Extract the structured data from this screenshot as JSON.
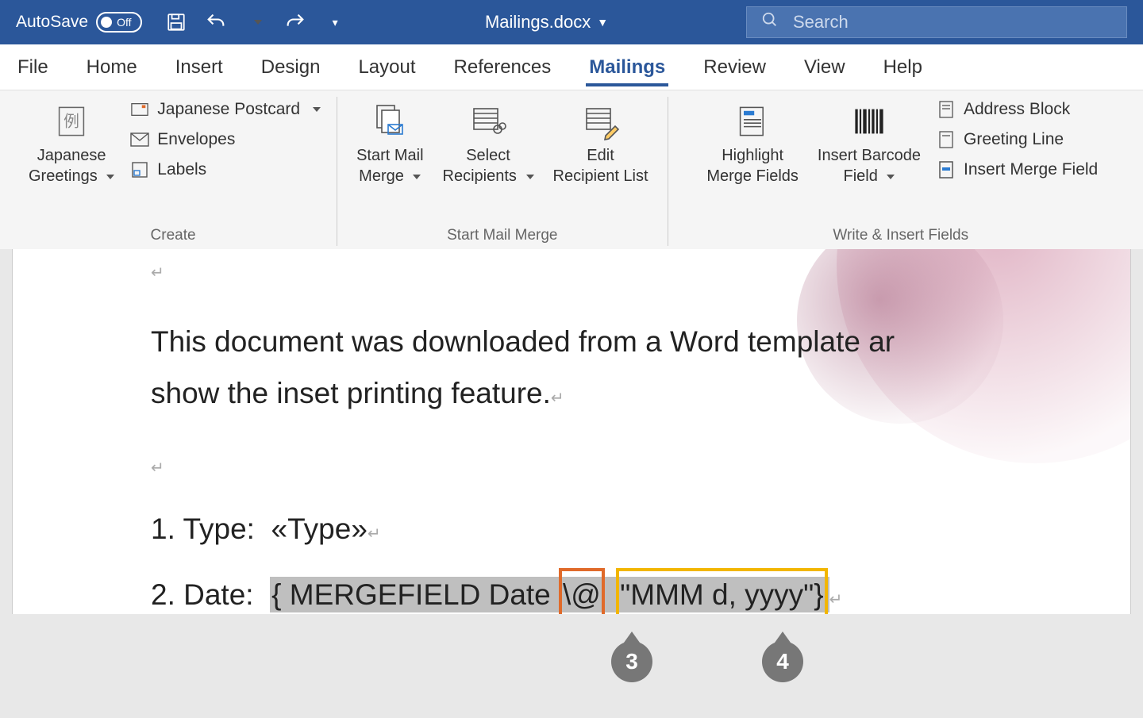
{
  "titlebar": {
    "autosave_label": "AutoSave",
    "autosave_state": "Off",
    "filename": "Mailings.docx",
    "search_placeholder": "Search"
  },
  "tabs": [
    "File",
    "Home",
    "Insert",
    "Design",
    "Layout",
    "References",
    "Mailings",
    "Review",
    "View",
    "Help"
  ],
  "active_tab_index": 6,
  "ribbon": {
    "groups": [
      {
        "label": "Create",
        "big": [
          {
            "line1": "Japanese",
            "line2": "Greetings"
          }
        ],
        "small": [
          {
            "label": "Japanese Postcard",
            "has_dropdown": true,
            "icon": "postcard-icon"
          },
          {
            "label": "Envelopes",
            "has_dropdown": false,
            "icon": "envelope-icon"
          },
          {
            "label": "Labels",
            "has_dropdown": false,
            "icon": "labels-icon"
          }
        ]
      },
      {
        "label": "Start Mail Merge",
        "big": [
          {
            "line1": "Start Mail",
            "line2": "Merge",
            "has_dropdown": true,
            "icon": "start-mail-merge-icon"
          },
          {
            "line1": "Select",
            "line2": "Recipients",
            "has_dropdown": true,
            "icon": "select-recipients-icon"
          },
          {
            "line1": "Edit",
            "line2": "Recipient List",
            "has_dropdown": false,
            "icon": "edit-recipient-list-icon"
          }
        ]
      },
      {
        "label": "Write & Insert Fields",
        "big": [
          {
            "line1": "Highlight",
            "line2": "Merge Fields",
            "has_dropdown": false,
            "icon": "highlight-merge-fields-icon"
          },
          {
            "line1": "Insert Barcode",
            "line2": "Field",
            "has_dropdown": true,
            "icon": "barcode-icon"
          }
        ],
        "small": [
          {
            "label": "Address Block",
            "icon": "address-block-icon"
          },
          {
            "label": "Greeting Line",
            "icon": "greeting-line-icon"
          },
          {
            "label": "Insert Merge Field",
            "icon": "insert-merge-field-icon"
          }
        ]
      }
    ]
  },
  "document": {
    "para1": "This document was downloaded from a Word template ar",
    "para2": "show the inset printing feature.",
    "item1_label": "1. Type:",
    "item1_field": "«Type»",
    "item2_label": "2. Date:",
    "item2_field_before": "{ MERGEFIELD Date ",
    "item2_field_switch": "\\@",
    "item2_field_format": "\"MMM d, yyyy\"}"
  },
  "callouts": {
    "c3": "3",
    "c4": "4"
  }
}
